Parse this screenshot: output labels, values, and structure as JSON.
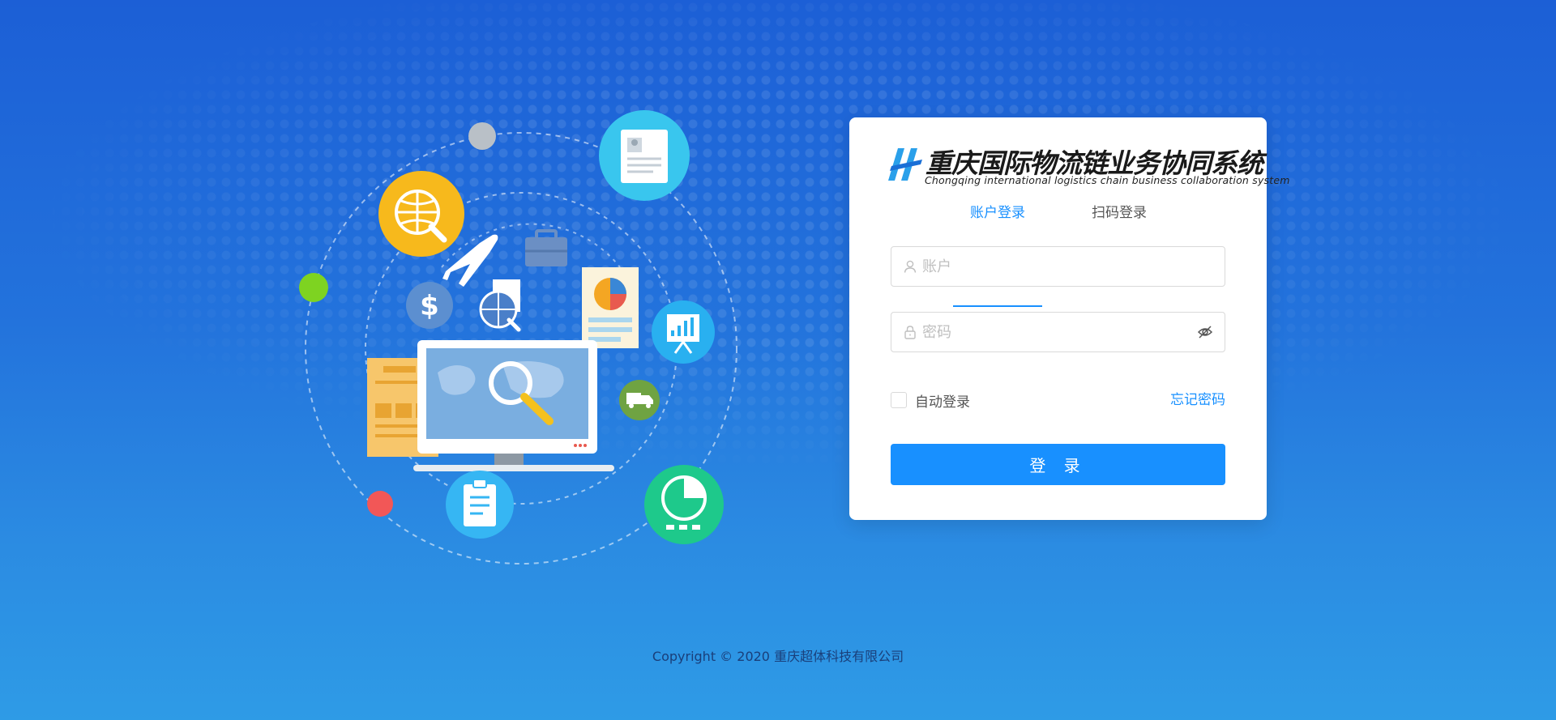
{
  "brand": {
    "title_cn": "重庆国际物流链业务协同系统",
    "title_en": "Chongqing international logistics chain business collaboration system"
  },
  "tabs": [
    {
      "label": "账户登录",
      "active": true
    },
    {
      "label": "扫码登录",
      "active": false
    }
  ],
  "form": {
    "account_placeholder": "账户",
    "account_value": "",
    "password_placeholder": "密码",
    "password_value": "",
    "remember_label": "自动登录",
    "remember_checked": false,
    "forgot_label": "忘记密码",
    "submit_label": "登 录"
  },
  "footer": {
    "copyright": "Copyright © 2020 重庆超体科技有限公司"
  },
  "colors": {
    "primary": "#1890ff",
    "background_top": "#1c5fd6",
    "background_bottom": "#2e9be6",
    "card": "#ffffff"
  }
}
